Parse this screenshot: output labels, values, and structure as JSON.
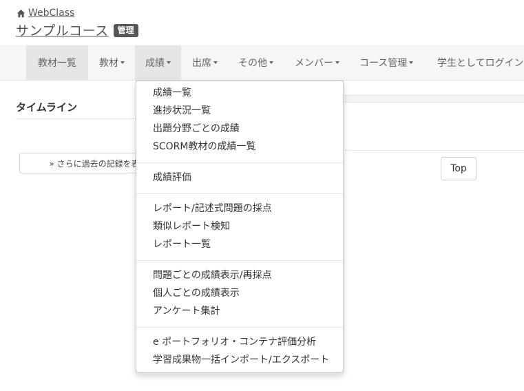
{
  "header": {
    "home_label": "WebClass",
    "course_name": "サンプルコース",
    "admin_badge": "管理"
  },
  "nav": {
    "items": [
      {
        "label": "教材一覧",
        "dropdown": false,
        "active": true
      },
      {
        "label": "教材",
        "dropdown": true,
        "active": false
      },
      {
        "label": "成績",
        "dropdown": true,
        "active": true
      },
      {
        "label": "出席",
        "dropdown": true,
        "active": false
      },
      {
        "label": "その他",
        "dropdown": true,
        "active": false
      },
      {
        "label": "メンバー",
        "dropdown": true,
        "active": false
      },
      {
        "label": "コース管理",
        "dropdown": true,
        "active": false
      },
      {
        "label": "学生としてログイン",
        "dropdown": false,
        "active": false
      }
    ]
  },
  "dropdown": {
    "groups": [
      [
        "成績一覧",
        "進捗状況一覧",
        "出題分野ごとの成績",
        "SCORM教材の成績一覧"
      ],
      [
        "成績評価"
      ],
      [
        "レポート/記述式問題の採点",
        "類似レポート検知",
        "レポート一覧"
      ],
      [
        "問題ごとの成績表示/再採点",
        "個人ごとの成績表示",
        "アンケート集計"
      ],
      [
        "e ポートフォリオ・コンテナ評価分析",
        "学習成果物一括インポート/エクスポート"
      ]
    ]
  },
  "main": {
    "timeline_title": "タイムライン",
    "more_button": "» さらに過去の記録を表示",
    "top_button": "Top"
  }
}
